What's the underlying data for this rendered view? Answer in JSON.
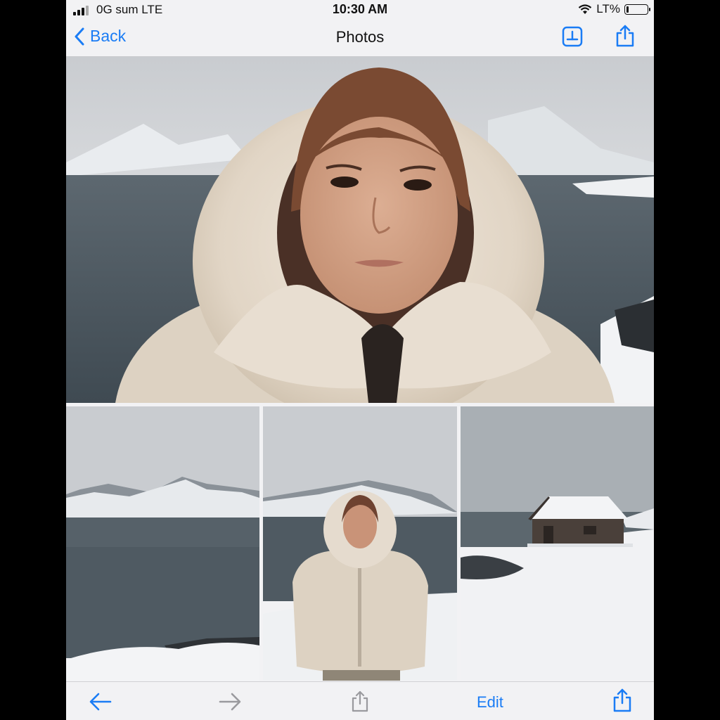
{
  "status_bar": {
    "carrier": "0G sum LTE",
    "time": "10:30 AM",
    "battery_label": "LT%",
    "battery_level": 0.1
  },
  "nav": {
    "back_label": "Back",
    "title": "Photos"
  },
  "toolbar": {
    "edit_label": "Edit"
  },
  "icons": {
    "back": "chevron-left-icon",
    "save": "save-to-device-icon",
    "share": "share-icon",
    "prev": "arrow-left-icon",
    "next": "arrow-right-icon"
  },
  "colors": {
    "accent": "#1a7cf5",
    "disabled": "#9a9a9e"
  }
}
